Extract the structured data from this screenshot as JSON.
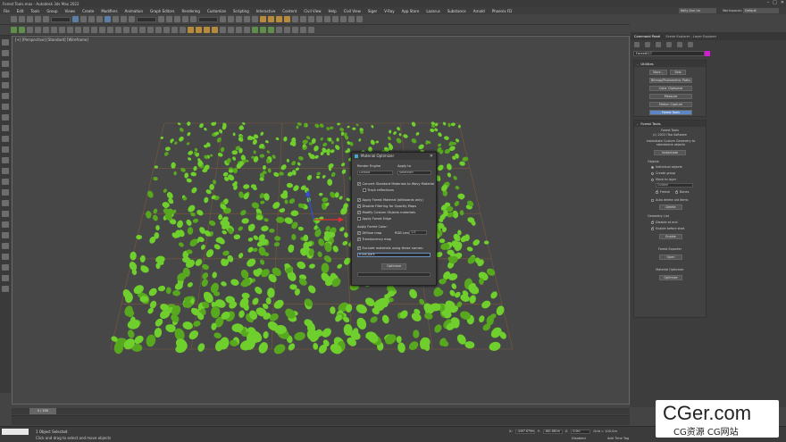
{
  "window": {
    "title": "Forest Tools.max - Autodesk 3ds Max 2022"
  },
  "menubar": {
    "items": [
      "File",
      "Edit",
      "Tools",
      "Group",
      "Views",
      "Create",
      "Modifiers",
      "Animation",
      "Graph Editors",
      "Rendering",
      "Customize",
      "Scripting",
      "Interactive",
      "Content",
      "Civil View",
      "Help",
      "Civil View",
      "Siger",
      "V-Ray",
      "App Store",
      "Lazarus",
      "Substance",
      "Arnold",
      "Phoenix FD"
    ],
    "signin": "Kelly Ann Un",
    "workspace_label": "Workspaces:",
    "workspace_value": "Default"
  },
  "viewport": {
    "label": "[+] [Perspective] [Standard] [Wireframe]"
  },
  "dialog": {
    "title": "Material Optimizer",
    "render_engine_label": "Render Engine",
    "render_engine_value": "Corona",
    "apply_to_label": "Apply to",
    "apply_to_value": "Selection",
    "convert_label": "Convert Standard Materials to Wavy Material",
    "track_label": "Track reflections",
    "apply_forest_label": "Apply Forest Material (billboards only)",
    "disable_filter_label": "Disable Filtering for Opacity Maps",
    "modify_custom_label": "Modify Custom Objects materials",
    "apply_edge_label": "Apply Forest Edge",
    "apply_colors_label": "Apply Forest Color:",
    "diffuse_label": "Diffuse map",
    "rgb_level_label": "RGB Level",
    "rgb_level_value": "1.0",
    "translucency_label": "Translucency map",
    "exclude_label": "Exclude materials using these names:",
    "exclude_value": "trunk,bark",
    "optimize_label": "Optimize"
  },
  "panel": {
    "tabs": [
      "Command Panel",
      "Scene Explorer - Layer Explorer"
    ],
    "object_name": "Forest017",
    "utilities_title": "Utilities",
    "utilities_more": "More...",
    "utilities_sets": "Sets",
    "utilities_buttons": [
      "Bitmap/Photometric Paths",
      "Color Clipboard",
      "Measure",
      "Motion Capture",
      "Forest Tools"
    ],
    "forest_tools_title": "Forest Tools",
    "forest_tools_heading": "Forest Tools",
    "forest_tools_copyright": "(c) 2022 iToo Software",
    "instantiate_text": "Instantiate Custom Geometry to standalone objects",
    "instantiate_btn": "Instantiate",
    "objects_group": "Objects",
    "radio_individual": "Individual objects",
    "radio_group": "Create group",
    "radio_layer": "Move to layer",
    "layer_dropdown": "Custom",
    "freeze_label": "Freeze",
    "bones_label": "Bones",
    "auto_delete_label": "Auto delete old items",
    "delete_btn": "Delete",
    "geometry_list_group": "Geometry List",
    "disable_at_end_label": "Disable at end",
    "enable_before_label": "Enable before start",
    "enable_btn": "Enable",
    "forest_exporter_label": "Forest Exporter",
    "open_btn": "Open",
    "material_optimizer_label": "Material Optimizer",
    "optimize_btn": "Optimize"
  },
  "timeline": {
    "slider": "0 / 100"
  },
  "status": {
    "selected": "1 Object Selected",
    "hint": "Click and drag to select and move objects",
    "x_label": "X:",
    "x_value": "-4497.679m",
    "y_label": "Y:",
    "y_value": "-661.861m",
    "z_label": "Z:",
    "z_value": "0.0m",
    "grid_label": "Grid = 100.0m",
    "disabled_label": "Disabled",
    "add_tag_label": "Add Time Tag"
  },
  "watermark": {
    "line1": "CGer.com",
    "line2": "CG资源 CG网站"
  },
  "colors": {
    "leaf": "#6fcf2d",
    "leaf_edge": "#58a81f",
    "grid": "#7a5a3a",
    "accent": "#5c86c4",
    "object_color": "#d21bd2"
  }
}
